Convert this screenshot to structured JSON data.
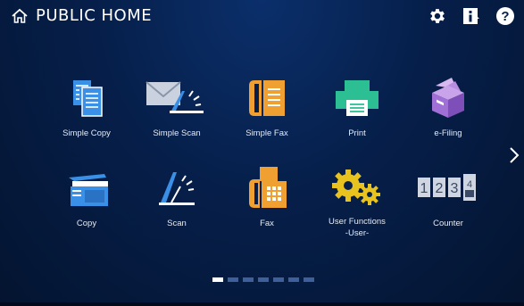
{
  "header": {
    "title": "PUBLIC HOME",
    "icons": [
      "home-icon",
      "settings-gear-icon",
      "info-icon",
      "help-icon"
    ]
  },
  "tiles": [
    {
      "label": "Simple Copy",
      "icon": "simple-copy-icon"
    },
    {
      "label": "Simple Scan",
      "icon": "simple-scan-icon"
    },
    {
      "label": "Simple Fax",
      "icon": "simple-fax-icon"
    },
    {
      "label": "Print",
      "icon": "print-icon"
    },
    {
      "label": "e-Filing",
      "icon": "e-filing-icon"
    },
    {
      "label": "Copy",
      "icon": "copy-icon"
    },
    {
      "label": "Scan",
      "icon": "scan-icon"
    },
    {
      "label": "Fax",
      "icon": "fax-icon"
    },
    {
      "label": "User Functions\n-User-",
      "icon": "user-functions-icon"
    },
    {
      "label": "Counter",
      "icon": "counter-icon"
    }
  ],
  "counter_digits": [
    "1",
    "2",
    "3",
    "4"
  ],
  "pager": {
    "pages": 7,
    "current": 1
  },
  "colors": {
    "accent_blue": "#3a8fe6",
    "orange": "#f0a030",
    "green": "#2cbf93",
    "purple": "#a170d6",
    "yellow": "#e8c320"
  }
}
